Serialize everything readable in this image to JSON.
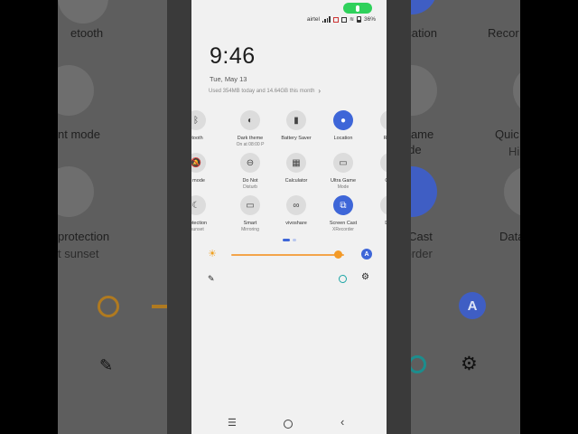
{
  "background": {
    "left": {
      "labels": [
        "etooth",
        "nt mode",
        "protection",
        "t sunset"
      ]
    },
    "right": {
      "labels": [
        "ocation",
        "Recor",
        "n Game",
        "lode",
        "Quic",
        "Hi",
        "en Cast",
        "corder",
        "Data"
      ],
      "auto_letter": "A"
    }
  },
  "statusbar": {
    "carrier": "airtel",
    "battery": "36%"
  },
  "header": {
    "time": "9:46",
    "date": "Tue, May 13",
    "usage": "Used 354MB today and 14.64GB this month"
  },
  "tiles": [
    {
      "label": "etooth",
      "sub": "",
      "icon": "bluetooth-icon",
      "on": false
    },
    {
      "label": "Dark theme",
      "sub": "On at 08:00 P",
      "icon": "dark-theme-icon",
      "on": false
    },
    {
      "label": "Battery Saver",
      "sub": "",
      "icon": "battery-saver-icon",
      "on": false
    },
    {
      "label": "Location",
      "sub": "",
      "icon": "location-icon",
      "on": true
    },
    {
      "label": "Recor",
      "sub": "",
      "icon": "record-icon",
      "on": false
    },
    {
      "label": "nt mode",
      "sub": "",
      "icon": "silent-mode-icon",
      "on": false
    },
    {
      "label": "Do Not",
      "sub": "Disturb",
      "icon": "do-not-disturb-icon",
      "on": false
    },
    {
      "label": "Calculator",
      "sub": "",
      "icon": "calculator-icon",
      "on": false
    },
    {
      "label": "Ultra Game",
      "sub": "Mode",
      "icon": "game-mode-icon",
      "on": false
    },
    {
      "label": "Quic",
      "sub": "Hi",
      "icon": "quick-icon",
      "on": false
    },
    {
      "label": "protection",
      "sub": "t sunset",
      "icon": "eye-protection-icon",
      "on": false
    },
    {
      "label": "Smart",
      "sub": "Mirroring",
      "icon": "smart-mirroring-icon",
      "on": false
    },
    {
      "label": "vivoshare",
      "sub": "",
      "icon": "vivoshare-icon",
      "on": false
    },
    {
      "label": "Screen Cast",
      "sub": "XRecorder",
      "icon": "screen-cast-icon",
      "on": true
    },
    {
      "label": "Data",
      "sub": "",
      "icon": "data-icon",
      "on": false
    }
  ],
  "brightness": {
    "level": 0.95,
    "auto_letter": "A"
  },
  "colors": {
    "accent": "#3e66d8",
    "brightness": "#f39a27",
    "mic": "#2fd15b"
  }
}
